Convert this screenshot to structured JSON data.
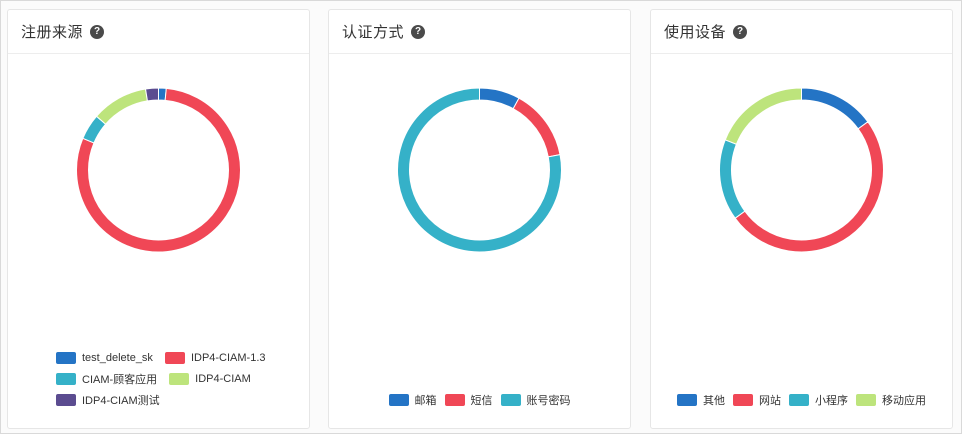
{
  "colors": {
    "blue": "#2474c5",
    "red": "#f04756",
    "teal": "#35b1c8",
    "lightgreen": "#bde47c",
    "purple": "#5b4c90"
  },
  "cards": [
    {
      "title": "注册来源",
      "help_icon": "help-icon",
      "chart_data": {
        "type": "pie",
        "variant": "donut",
        "categories": [
          "test_delete_sk",
          "IDP4-CIAM-1.3",
          "CIAM-顾客应用",
          "IDP4-CIAM",
          "IDP4-CIAM测试"
        ],
        "values": [
          1.5,
          79,
          5,
          11,
          2.5
        ],
        "colors": [
          "#2474c5",
          "#f04756",
          "#35b1c8",
          "#bde47c",
          "#5b4c90"
        ],
        "legend": "bottom"
      },
      "legend": [
        {
          "label": "test_delete_sk",
          "color": "#2474c5"
        },
        {
          "label": "IDP4-CIAM-1.3",
          "color": "#f04756"
        },
        {
          "label": "CIAM-顾客应用",
          "color": "#35b1c8"
        },
        {
          "label": "IDP4-CIAM",
          "color": "#bde47c"
        },
        {
          "label": "IDP4-CIAM测试",
          "color": "#5b4c90"
        }
      ]
    },
    {
      "title": "认证方式",
      "help_icon": "help-icon",
      "chart_data": {
        "type": "pie",
        "variant": "donut",
        "categories": [
          "邮箱",
          "短信",
          "账号密码"
        ],
        "values": [
          8,
          14,
          78
        ],
        "colors": [
          "#2474c5",
          "#f04756",
          "#35b1c8"
        ],
        "legend": "bottom"
      },
      "legend": [
        {
          "label": "邮箱",
          "color": "#2474c5"
        },
        {
          "label": "短信",
          "color": "#f04756"
        },
        {
          "label": "账号密码",
          "color": "#35b1c8"
        }
      ]
    },
    {
      "title": "使用设备",
      "help_icon": "help-icon",
      "chart_data": {
        "type": "pie",
        "variant": "donut",
        "categories": [
          "其他",
          "网站",
          "小程序",
          "移动应用"
        ],
        "values": [
          15,
          50,
          16,
          19
        ],
        "colors": [
          "#2474c5",
          "#f04756",
          "#35b1c8",
          "#bde47c"
        ],
        "legend": "bottom"
      },
      "legend": [
        {
          "label": "其他",
          "color": "#2474c5"
        },
        {
          "label": "网站",
          "color": "#f04756"
        },
        {
          "label": "小程序",
          "color": "#35b1c8"
        },
        {
          "label": "移动应用",
          "color": "#bde47c"
        }
      ]
    }
  ]
}
